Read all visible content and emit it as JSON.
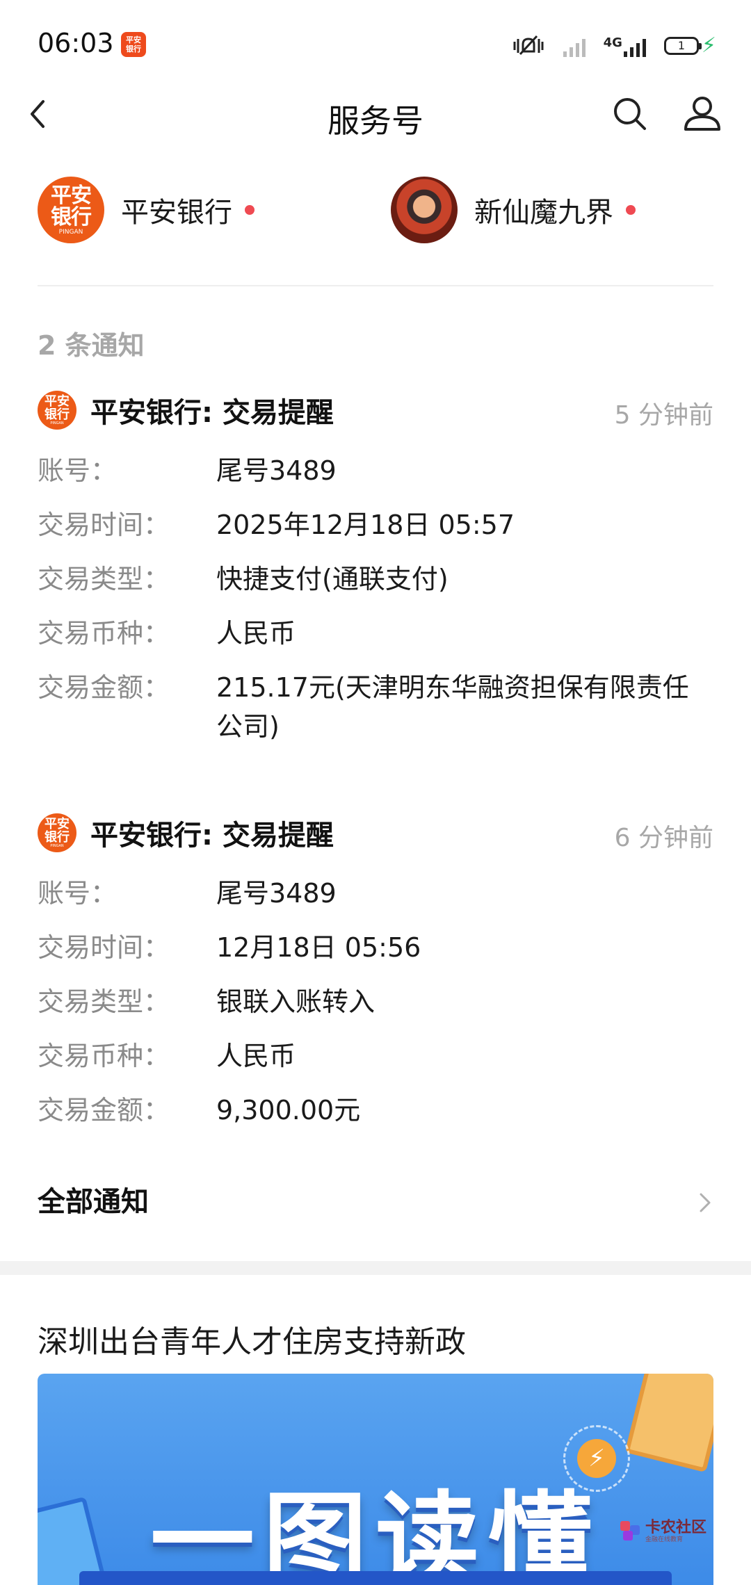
{
  "status_bar": {
    "time": "06:03",
    "app_icon_text": [
      "平安",
      "银行"
    ],
    "network_label": "4G",
    "battery_level": "1",
    "icons": [
      "vibrate-mute-icon",
      "signal-1-icon",
      "signal-2-icon",
      "battery-icon",
      "charging-icon"
    ]
  },
  "nav": {
    "title": "服务号",
    "back_icon": "back-arrow-icon",
    "search_icon": "search-icon",
    "user_icon": "user-icon"
  },
  "accounts": [
    {
      "name": "平安银行",
      "avatar_lines": [
        "平安",
        "银行",
        "PINGAN"
      ],
      "unread": true
    },
    {
      "name": "新仙魔九界",
      "avatar_icon": "game-character-avatar",
      "unread": true
    }
  ],
  "notification_count": "2 条通知",
  "notifications": [
    {
      "title": "平安银行: 交易提醒",
      "time": "5 分钟前",
      "logo_lines": [
        "平安",
        "银行",
        "PINGAN"
      ],
      "fields": [
        {
          "label": "账号：",
          "value": "尾号3489"
        },
        {
          "label": "交易时间：",
          "value": "2025年12月18日 05:57"
        },
        {
          "label": "交易类型：",
          "value": "快捷支付(通联支付)"
        },
        {
          "label": "交易币种：",
          "value": "人民币"
        },
        {
          "label": "交易金额：",
          "value": "215.17元(天津明东华融资担保有限责任公司)"
        }
      ]
    },
    {
      "title": "平安银行: 交易提醒",
      "time": "6 分钟前",
      "logo_lines": [
        "平安",
        "银行",
        "PINGAN"
      ],
      "fields": [
        {
          "label": "账号：",
          "value": "尾号3489"
        },
        {
          "label": "交易时间：",
          "value": "12月18日 05:56"
        },
        {
          "label": "交易类型：",
          "value": "银联入账转入"
        },
        {
          "label": "交易币种：",
          "value": "人民币"
        },
        {
          "label": "交易金额：",
          "value": "9,300.00元"
        }
      ]
    }
  ],
  "all_notifications_label": "全部通知",
  "article": {
    "title": "深圳出台青年人才住房支持新政",
    "banner_text": "一图读懂"
  },
  "watermark": {
    "text": "卡农社区",
    "sub": "金融在线教育"
  },
  "colors": {
    "brand_orange": "#ec5a17",
    "unread_dot": "#ef4a52",
    "muted_text": "#a7a7a7",
    "label_text": "#8a8a8a",
    "banner_blue": "#4a97ec",
    "charging_green": "#2bbd6e"
  }
}
